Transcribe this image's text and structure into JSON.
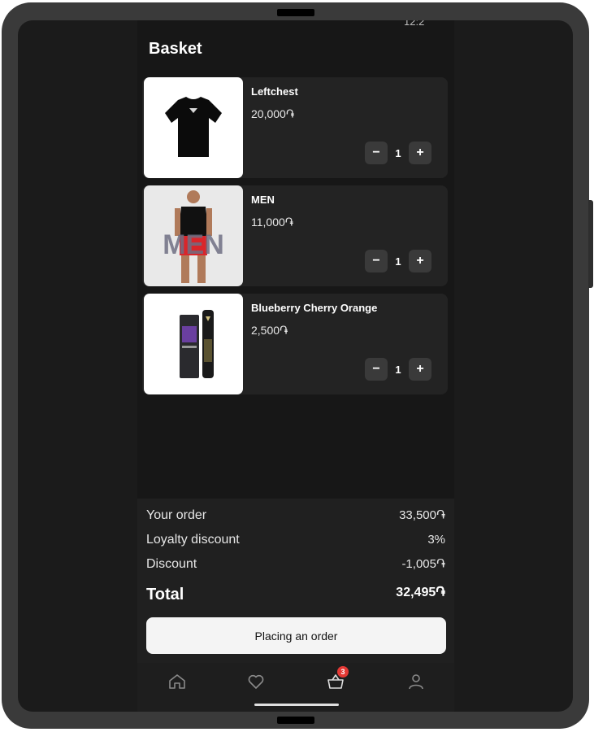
{
  "status_fragment": "12:2",
  "header": {
    "title": "Basket"
  },
  "items": [
    {
      "name": "Leftchest",
      "price": "20,000֏",
      "qty": "1",
      "image_icon": "tshirt-icon"
    },
    {
      "name": "MEN",
      "price": "11,000֏",
      "qty": "1",
      "image_icon": "model-photo-icon",
      "image_overlay_text": "MEN"
    },
    {
      "name": "Blueberry Cherry Orange",
      "price": "2,500֏",
      "qty": "1",
      "image_icon": "vape-device-icon"
    }
  ],
  "qty_controls": {
    "minus": "−",
    "plus": "+"
  },
  "summary": {
    "rows": [
      {
        "label": "Your order",
        "value": "33,500֏"
      },
      {
        "label": "Loyalty discount",
        "value": "3%"
      },
      {
        "label": "Discount",
        "value": "-1,005֏"
      }
    ],
    "total_label": "Total",
    "total_value": "32,495֏",
    "order_button": "Placing an order"
  },
  "tabbar": {
    "items": [
      {
        "icon": "home-icon"
      },
      {
        "icon": "heart-icon"
      },
      {
        "icon": "basket-icon",
        "badge": "3"
      },
      {
        "icon": "profile-icon"
      }
    ]
  },
  "colors": {
    "background": "#171717",
    "card": "#232323",
    "accent_badge": "#e53935",
    "button_bg": "#f4f4f4"
  }
}
